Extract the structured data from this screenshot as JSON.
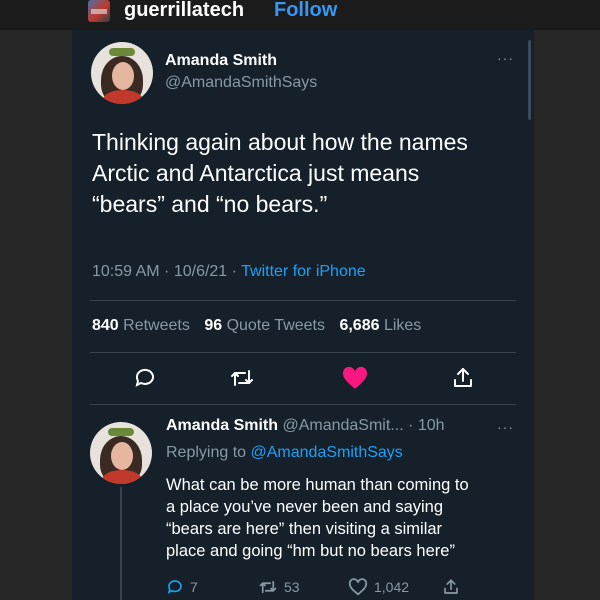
{
  "ig": {
    "username": "guerrillatech",
    "follow_label": "Follow"
  },
  "tweet": {
    "name": "Amanda Smith",
    "handle": "@AmandaSmithSays",
    "text_lines": [
      "Thinking again about how the names",
      "Arctic and Antarctica just means",
      "“bears” and “no bears.”"
    ],
    "timestamp": "10:59 AM · 10/6/21 · ",
    "source": "Twitter for iPhone",
    "retweets_count": "840",
    "retweets_label": "Retweets",
    "quotes_count": "96",
    "quotes_label": "Quote Tweets",
    "likes_count": "6,686",
    "likes_label": "Likes",
    "more": "···",
    "liked": true,
    "like_color": "#f91880"
  },
  "reply": {
    "name": "Amanda Smith",
    "handle_time": "@AmandaSmit... · 10h",
    "more": "···",
    "replying_prefix": "Replying to ",
    "replying_mention": "@AmandaSmithSays",
    "text_lines": [
      "What can be more human than coming to",
      "a place you’ve never been and saying",
      "“bears are here” then visiting a similar",
      "place and going “hm but no bears here”"
    ],
    "reply_count": "7",
    "retweet_count": "53",
    "like_count": "1,042"
  },
  "icons": {
    "reply": "comment-icon",
    "retweet": "retweet-icon",
    "like": "heart-icon",
    "share": "share-icon"
  },
  "colors": {
    "card_bg": "#15202b",
    "accent": "#1da1f2",
    "muted": "#8899a6",
    "follow": "#3897f0"
  }
}
